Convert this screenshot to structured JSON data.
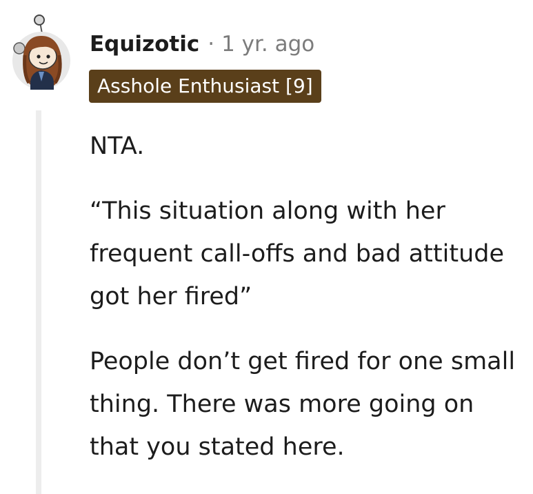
{
  "comment": {
    "author": "Equizotic",
    "separator": "·",
    "timestamp": "1 yr. ago",
    "flair": "Asshole Enthusiast [9]",
    "paragraphs": [
      "NTA.",
      "“This situation along with her frequent call-offs and bad attitude got her fired”",
      "People don’t get fired for one small thing. There was more going on that you stated here."
    ]
  },
  "colors": {
    "flair_bg": "#5a3f1a",
    "flair_text": "#ffffff",
    "meta_text": "#7c7c7c",
    "thread_line": "#ededed"
  },
  "icons": {
    "avatar": "snoo-avatar-icon"
  }
}
